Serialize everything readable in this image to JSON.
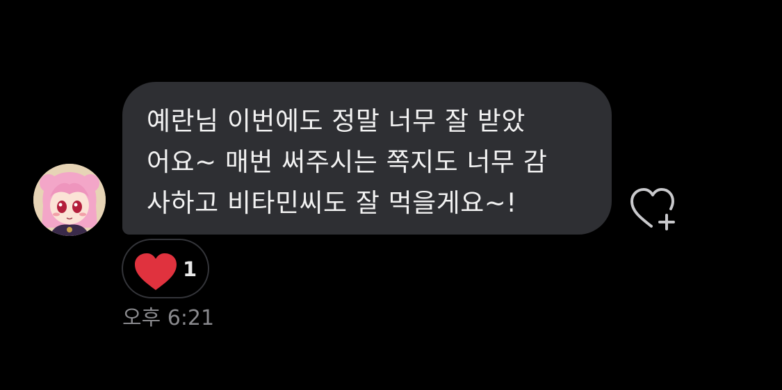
{
  "message": {
    "lines": [
      "예란님 이번에도 정말 너무 잘 받았",
      "어요~ 매번 써주시는 쪽지도 너무 감",
      "사하고 비타민씨도 잘 먹을게요~!"
    ],
    "reaction": {
      "icon": "heart-icon",
      "color": "#e0323e",
      "count": "1"
    },
    "timestamp": "오후 6:21"
  },
  "actions": {
    "like_icon": "heart-plus-icon"
  },
  "colors": {
    "background": "#000000",
    "bubble": "#2e2f33",
    "text": "#f2f2f2",
    "muted": "#8a8a8e",
    "heart": "#e0323e"
  }
}
